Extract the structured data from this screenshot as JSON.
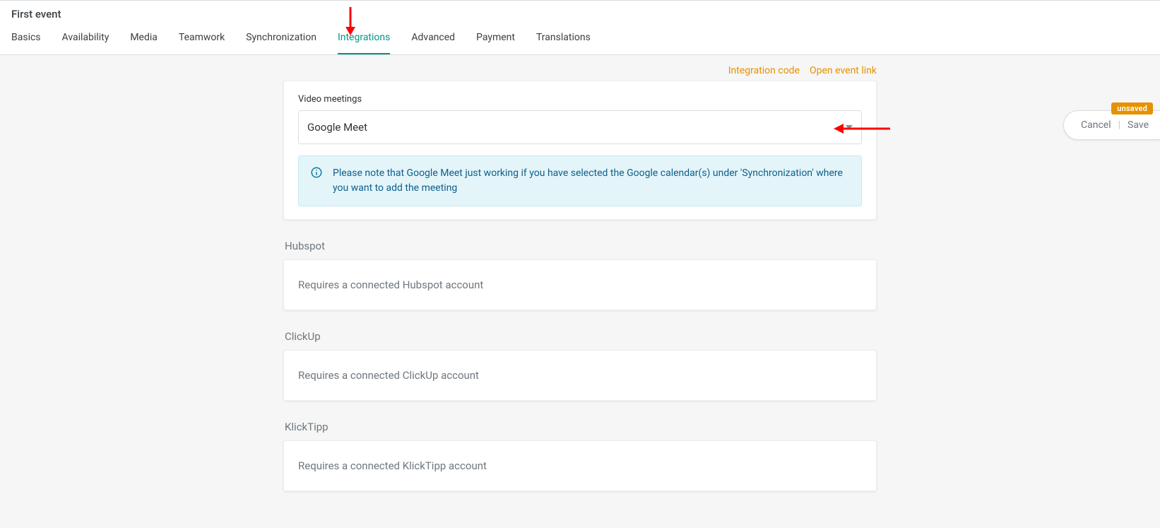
{
  "header": {
    "title": "First event",
    "tabs": [
      "Basics",
      "Availability",
      "Media",
      "Teamwork",
      "Synchronization",
      "Integrations",
      "Advanced",
      "Payment",
      "Translations"
    ],
    "active_tab": "Integrations"
  },
  "top_links": {
    "integration_code": "Integration code",
    "open_event": "Open event link"
  },
  "video_meetings": {
    "label": "Video meetings",
    "selected": "Google Meet",
    "info": "Please note that Google Meet just working if you have selected the Google calendar(s) under 'Synchronization' where you want to add the meeting"
  },
  "sections": [
    {
      "title": "Hubspot",
      "message": "Requires a connected Hubspot account"
    },
    {
      "title": "ClickUp",
      "message": "Requires a connected ClickUp account"
    },
    {
      "title": "KlickTipp",
      "message": "Requires a connected KlickTipp account"
    }
  ],
  "save_pill": {
    "cancel": "Cancel",
    "save": "Save",
    "badge": "unsaved"
  }
}
